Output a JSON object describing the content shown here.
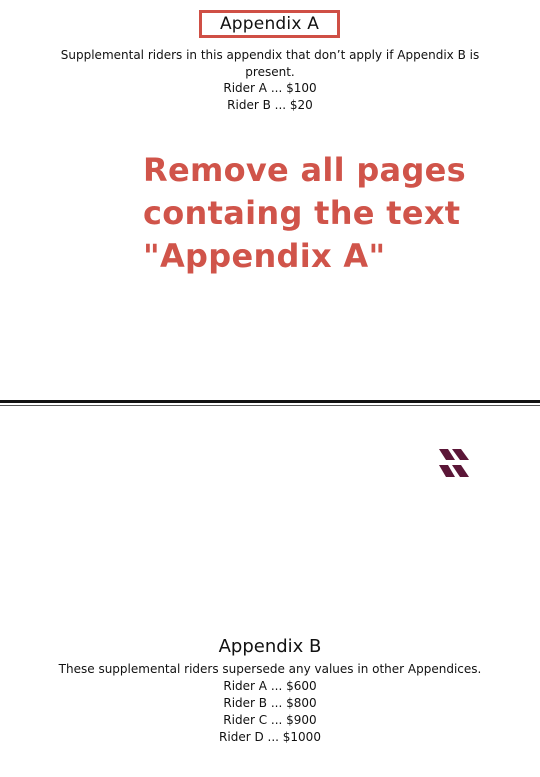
{
  "appendix_a": {
    "title": "Appendix A",
    "description": "Supplemental riders in this appendix that don’t apply if Appendix B is present.",
    "riders": [
      "Rider A ... $100",
      "Rider B ... $20"
    ]
  },
  "instruction": {
    "lines": [
      "Remove all pages",
      "containg the text",
      "\"Appendix A\""
    ]
  },
  "logo": {
    "icon": "four-parallelogram-logo-icon",
    "color": "#5b1637"
  },
  "appendix_b": {
    "title": "Appendix B",
    "description": "These supplemental riders supersede any values in other Appendices.",
    "riders": [
      "Rider A ... $600",
      "Rider B ... $800",
      "Rider C ... $900",
      "Rider D ... $1000"
    ]
  },
  "colors": {
    "accent_red": "#cf4f45",
    "instruction_red": "#d0544a",
    "separator": "#111111"
  }
}
